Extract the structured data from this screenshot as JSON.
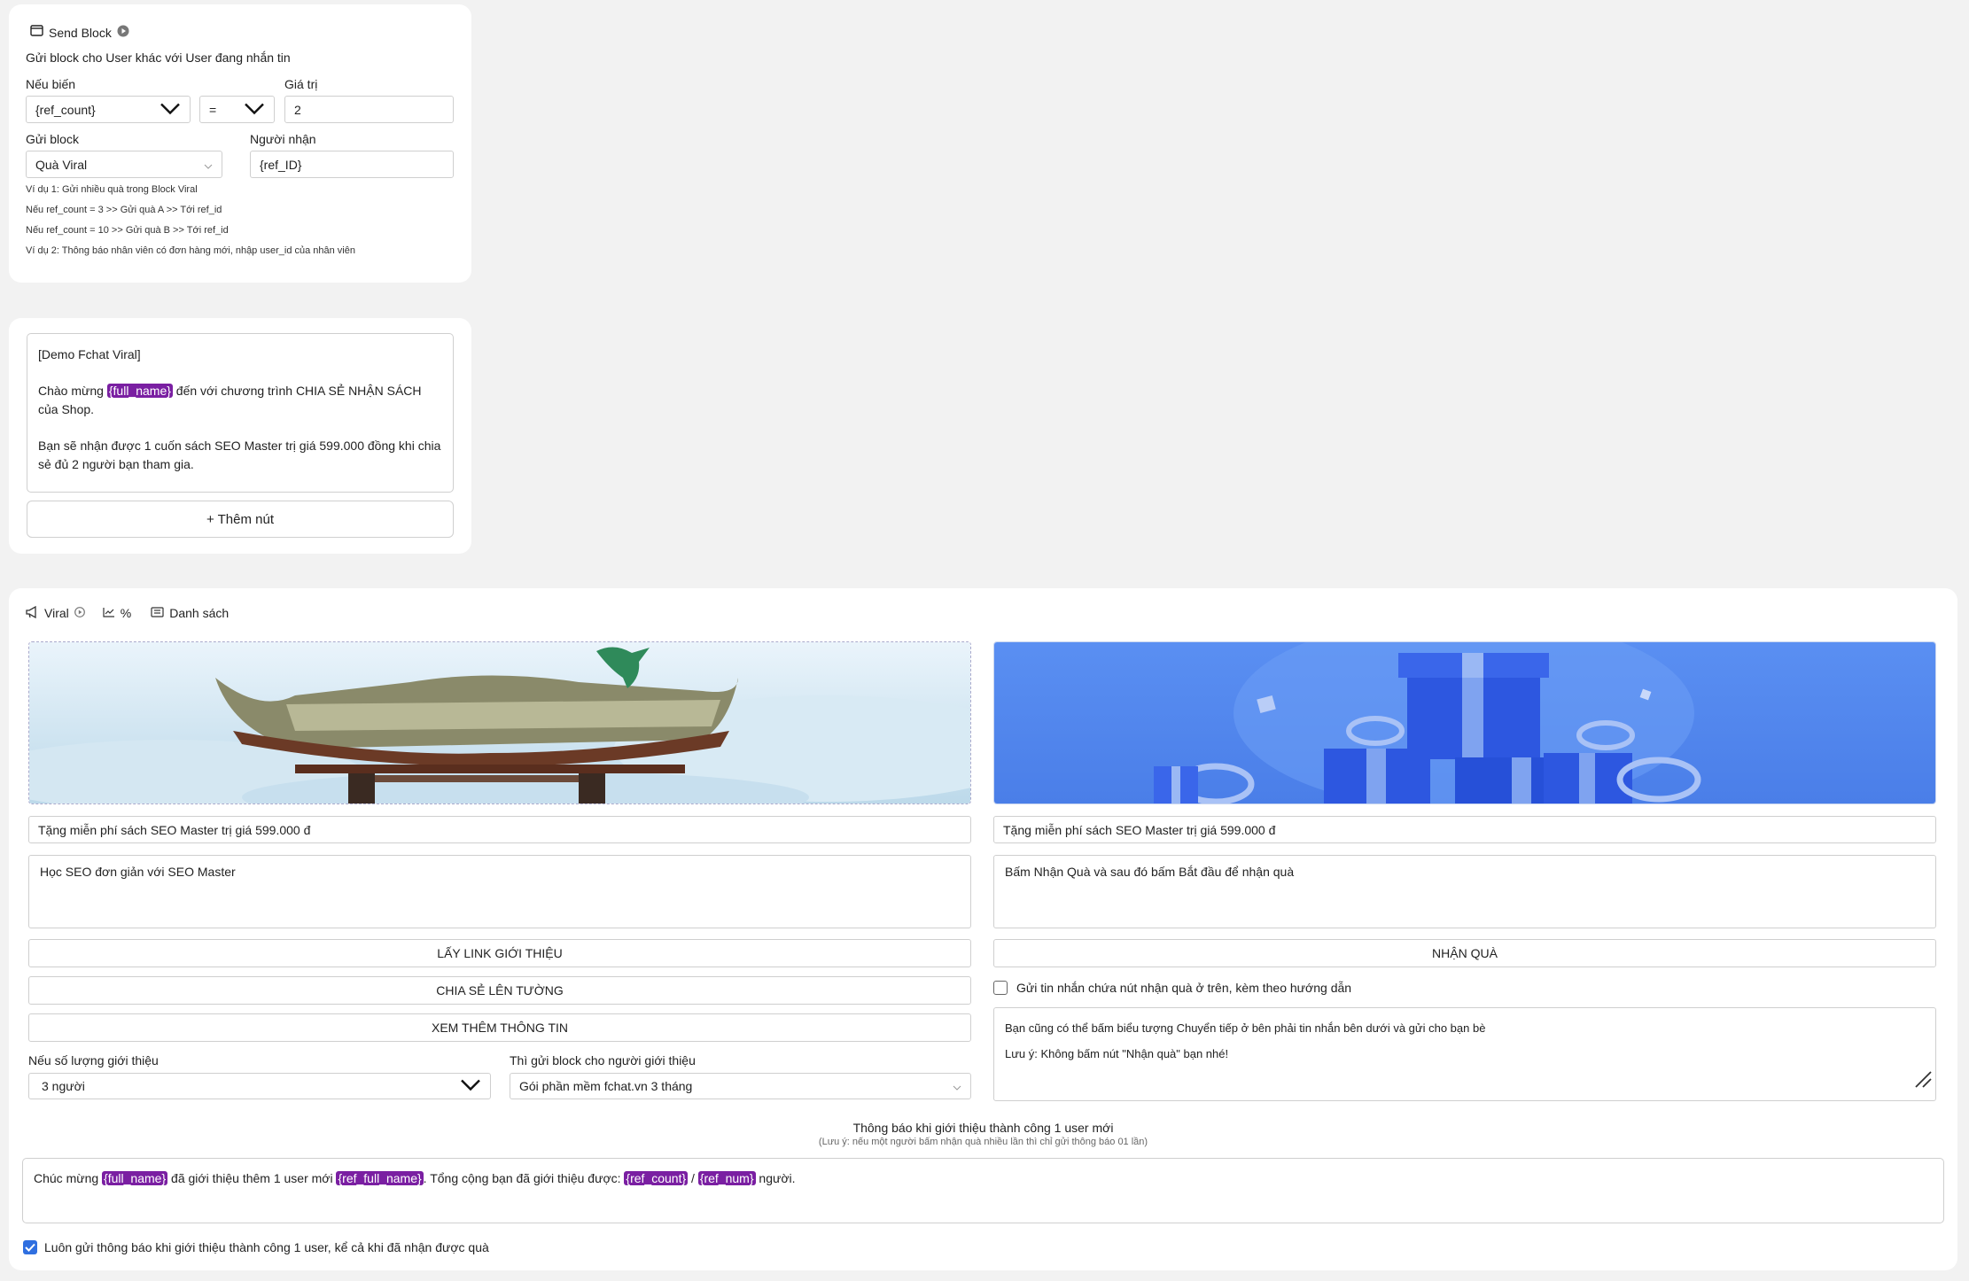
{
  "send_block": {
    "title": "Send Block",
    "subtitle": "Gửi block cho User khác với User đang nhắn tin",
    "if_var_label": "Nếu biến",
    "var_value": "{ref_count}",
    "operator": "=",
    "value_label": "Giá trị",
    "value": "2",
    "send_block_label": "Gửi block",
    "block_value": "Quà Viral",
    "recipient_label": "Người nhận",
    "recipient_value": "{ref_ID}",
    "examples": [
      "Ví dụ 1: Gửi nhiều quà trong Block Viral",
      "Nếu ref_count = 3 >> Gửi quà A >> Tới ref_id",
      "Nếu ref_count = 10 >> Gửi quà B >> Tới ref_id",
      "Ví dụ 2: Thông báo nhân viên có đơn hàng mới, nhập user_id của nhân viên"
    ]
  },
  "text_block": {
    "line1": "[Demo Fchat Viral]",
    "line2_pre": "Chào mừng ",
    "line2_tag": "{full_name}",
    "line2_post": " đến với chương trình CHIA SẺ NHẬN SÁCH của Shop.",
    "line3": "Bạn sẽ nhận được 1 cuốn sách SEO Master trị giá 599.000 đồng khi chia sẻ đủ 2 người bạn tham gia.",
    "add_button": "+ Thêm nút"
  },
  "viral": {
    "tab_viral": "Viral",
    "tab_percent": "%",
    "tab_list": "Danh sách",
    "left": {
      "title": "Tặng miễn phí sách SEO Master trị giá 599.000 đ",
      "description": "Học SEO đơn giản với SEO Master",
      "buttons": [
        "LẤY LINK GIỚI THIỆU",
        "CHIA SẺ LÊN TƯỜNG",
        "XEM THÊM THÔNG TIN"
      ]
    },
    "right": {
      "title": "Tặng miễn phí sách SEO Master trị giá 599.000 đ",
      "description": "Bấm Nhận Quà và sau đó bấm Bắt đầu để nhận quà",
      "button": "NHẬN QUÀ",
      "checkbox_label": "Gửi tin nhắn chứa nút nhận quà ở trên, kèm theo hướng dẫn",
      "guide_line1": "Bạn cũng có thể bấm biểu tượng Chuyển tiếp ở bên phải tin nhắn bên dưới và gửi cho bạn bè",
      "guide_line2": "Lưu ý: Không bấm nút \"Nhận quà\" bạn nhé!"
    },
    "ref_count_label": "Nếu số lượng giới thiệu",
    "ref_count_value": "3 người",
    "send_block_label": "Thì gửi block cho người giới thiệu",
    "send_block_value": "Gói phần mềm fchat.vn 3 tháng",
    "notify_title": "Thông báo khi giới thiệu thành công 1 user mới",
    "notify_note": "(Lưu ý: nếu một người bấm nhận quà nhiều lần thì chỉ gửi thông báo 01 lần)",
    "notify": {
      "p1": "Chúc mừng ",
      "t1": "{full_name}",
      "p2": " đã giới thiệu thêm 1 user mới ",
      "t2": "{ref_full_name}",
      "p3": ". Tổng cộng bạn đã giới thiệu được: ",
      "t3": "{ref_count}",
      "p4": " / ",
      "t4": "{ref_num}",
      "p5": " người."
    },
    "always_notify_label": "Luôn gửi thông báo khi giới thiệu thành công 1 user, kể cả khi đã nhận được quà",
    "always_notify_checked": true
  },
  "colors": {
    "tag": "#7a1fa2",
    "checkbox": "#2f6fe0",
    "gift_bg": "#4f86f0"
  }
}
